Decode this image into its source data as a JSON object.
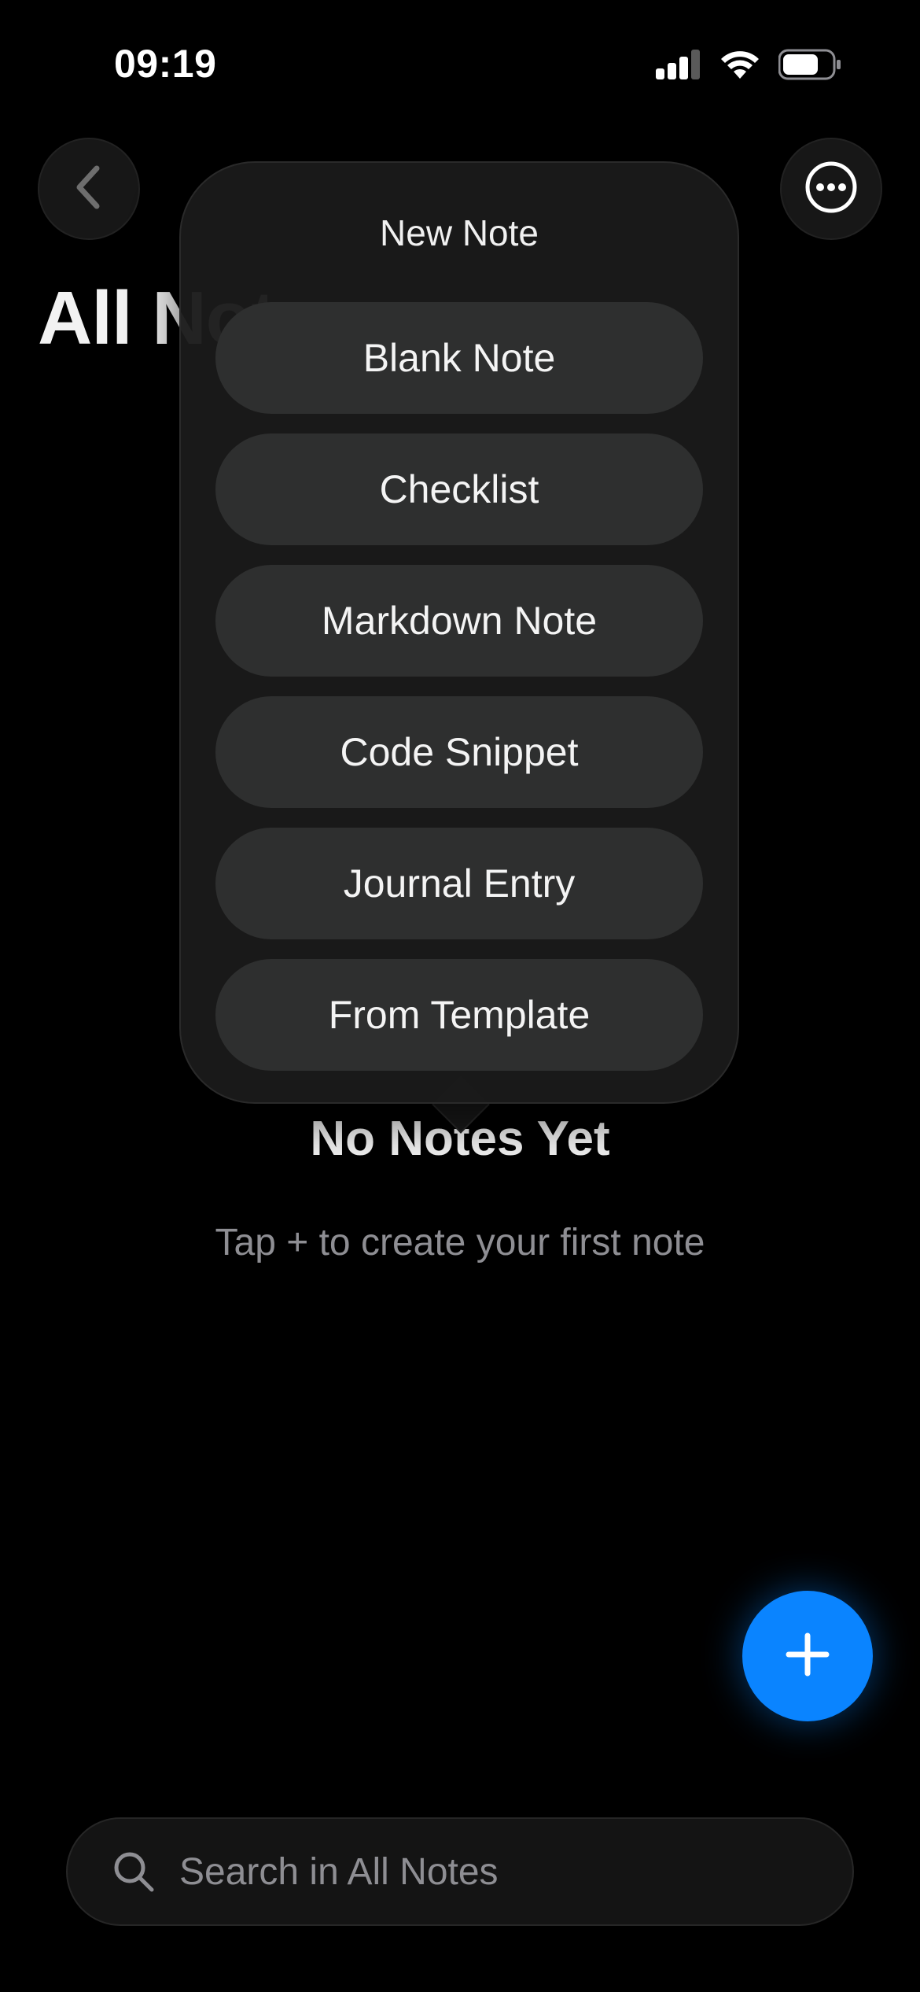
{
  "status_bar": {
    "time": "09:19",
    "icons": [
      "cellular-signal-icon",
      "wifi-icon",
      "battery-icon"
    ]
  },
  "header": {
    "back_icon": "chevron-left-icon",
    "more_icon": "ellipsis-circle-icon",
    "title": "All Notes"
  },
  "popover": {
    "title": "New Note",
    "items": [
      {
        "label": "Blank Note"
      },
      {
        "label": "Checklist"
      },
      {
        "label": "Markdown Note"
      },
      {
        "label": "Code Snippet"
      },
      {
        "label": "Journal Entry"
      },
      {
        "label": "From Template"
      }
    ]
  },
  "empty_state": {
    "title": "No Notes Yet",
    "subtitle": "Tap + to create your first note"
  },
  "fab": {
    "icon": "plus-icon",
    "color": "#0a84ff"
  },
  "search": {
    "placeholder": "Search in All Notes",
    "icon": "search-icon"
  }
}
